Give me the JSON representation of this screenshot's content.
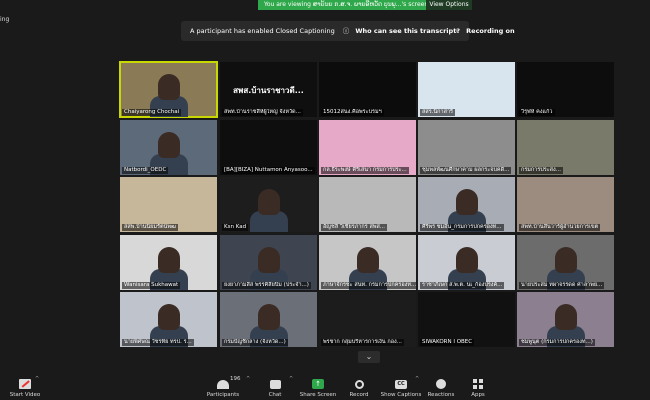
{
  "share_bar": {
    "text": "You are viewing ສາຍ້ນຍ ກ.ສ.ຈ. ພາຍອີຫວັດ ບຸນພຸ...'s screen",
    "view_options": "View Options"
  },
  "top_left_text": "ing",
  "cc_banner": {
    "message": "A participant has enabled Closed Captioning",
    "question": "Who can see this transcript?",
    "recording": "Recording on",
    "close": "×"
  },
  "tiles": [
    {
      "name": "Chaiyarong Chochai",
      "bg": "#8a7a55",
      "person": true,
      "active": true
    },
    {
      "name": "สพท.บ้านราชสีห์ผู้ใหญ่ จังหวัด...",
      "bg": "#0f0f0f",
      "center_text": "สพส.บ้านราชาวดี..."
    },
    {
      "name": "15012สนง.คือพระบรมฯ",
      "bg": "#0c0c0c"
    },
    {
      "name": "สสร.นิกาสารี",
      "bg": "#d9e5ee"
    },
    {
      "name": "วิรุฬห์ คงแก้ว",
      "bg": "#0d0d0d"
    },
    {
      "name": "Natbordi_OEDC",
      "bg": "#5d6a7a",
      "person": true
    },
    {
      "name": "[BA][BIZA] Nuttamon Anyasoo...",
      "bg": "#0e0e0e"
    },
    {
      "name": "กล.ธีระพงษ์ คีรีเสนา กรมการประ...",
      "bg": "#e7a9c8"
    },
    {
      "name": "ชุมพลพัฒนศึกษาคาม ผลกระจบคดี...",
      "bg": "#8d8d8d"
    },
    {
      "name": "กรมการประสง...",
      "bg": "#7a7a6a"
    },
    {
      "name": "สสพ.บ้านนิยมรัตน์พฒ",
      "bg": "#c7b79a"
    },
    {
      "name": "Ksn Kad",
      "bg": "#1d1d1d",
      "person": true
    },
    {
      "name": "อัญชลี วิเชียรภากร สพส...",
      "bg": "#b9b9b9"
    },
    {
      "name": "ศิริพร ชมอิน_กรมการปกครองท...",
      "bg": "#a8adb5",
      "person": true
    },
    {
      "name": "สพท.บ้านสิ้นวาร์ผู้อำนวยการเขต",
      "bg": "#9c8c80"
    },
    {
      "name": "Wanisara Sukhawat",
      "bg": "#d8d8d8",
      "person": true
    },
    {
      "name": "ยงยาภามสิส พรรคิสิยบิม (ประจำ...)",
      "bg": "#3f4550",
      "person": true
    },
    {
      "name": "ภาษาจักรชะ สนท. กรมการปกครองท...",
      "bg": "#c6c6c6",
      "person": true
    },
    {
      "name": "ราชาภิเษก ส.พ.ต. นเ_ก้องปรงค์...",
      "bg": "#c9ccd3",
      "person": true
    },
    {
      "name": "นายประสม ทผาจรรดด ศาลาพย...",
      "bg": "#6c6c6c",
      "person": true
    },
    {
      "name": "นายพิศษณ วัชรทิย ทรป. ร...",
      "bg": "#bfc4cc",
      "person": true
    },
    {
      "name": "กรมบัญชีกลาง (จังหวัด...)",
      "bg": "#6b6f78",
      "person": true
    },
    {
      "name": "พรชาก กลุ่มบริหารการเงิน กอง...",
      "bg": "#1c1c1c"
    },
    {
      "name": "SIWAKORN I OBEC",
      "bg": "#111111"
    },
    {
      "name": "ชมพูนุต (กรมการปกครองท...)",
      "bg": "#8b7f90",
      "person": true
    }
  ],
  "toolbar": {
    "start_video": "Start Video",
    "participants": "Participants",
    "participants_count": "196",
    "chat": "Chat",
    "share": "Share Screen",
    "record": "Record",
    "captions": "Show Captions",
    "reactions": "Reactions",
    "apps": "Apps"
  },
  "colors": {
    "accent_green": "#2ea84a",
    "active_speaker": "#c8d800"
  }
}
